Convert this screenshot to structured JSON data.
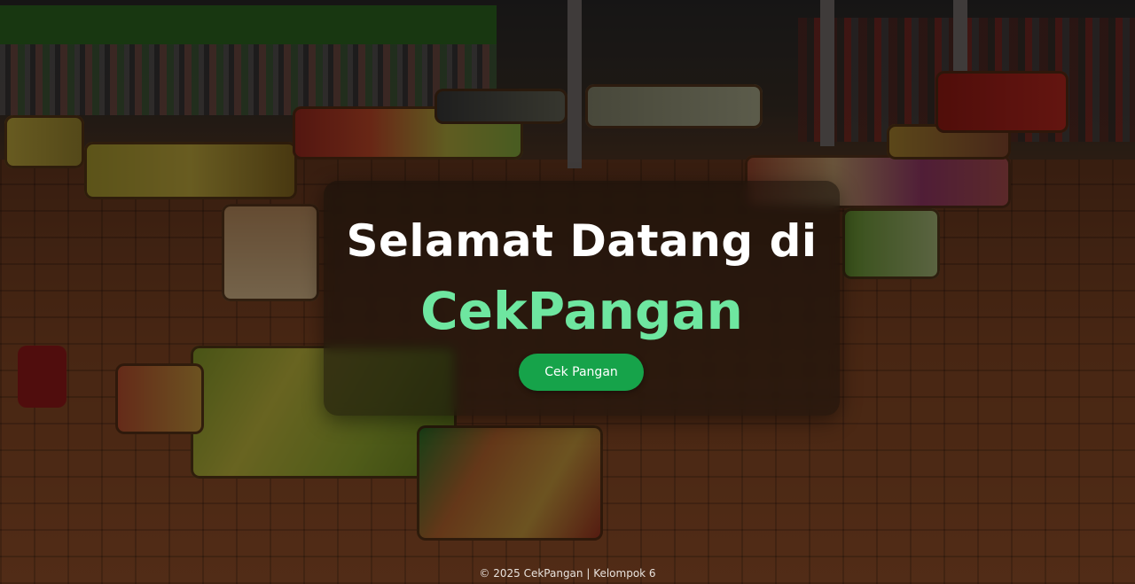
{
  "hero": {
    "title": "Selamat Datang di",
    "brand": "CekPangan",
    "cta_label": "Cek Pangan"
  },
  "footer": {
    "text": "© 2025 CekPangan | Kelompok 6"
  },
  "colors": {
    "brand_green": "#6ee6a0",
    "button_green": "#16a34a",
    "title_white": "#ffffff"
  }
}
